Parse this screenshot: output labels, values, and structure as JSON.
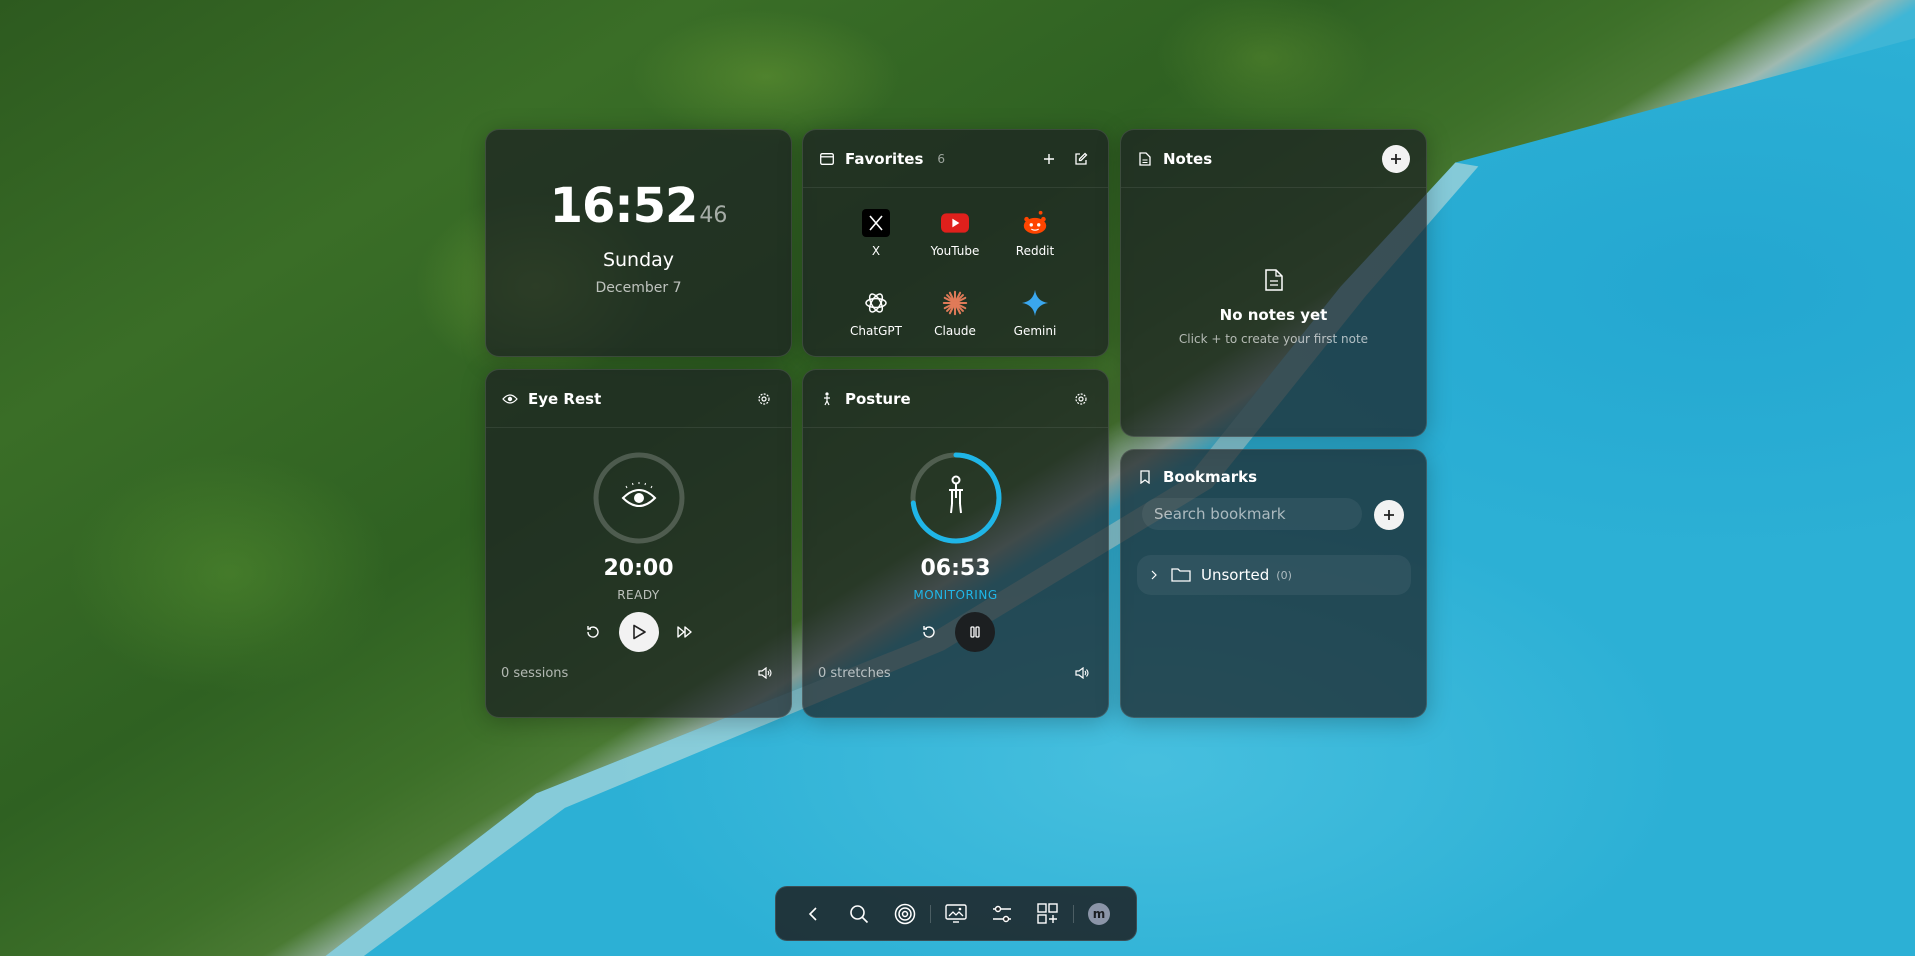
{
  "clock": {
    "hours_minutes": "16:52",
    "seconds": "46",
    "day": "Sunday",
    "date": "December 7"
  },
  "favorites": {
    "title": "Favorites",
    "count": "6",
    "items": [
      {
        "label": "X",
        "icon": "x-logo-icon"
      },
      {
        "label": "YouTube",
        "icon": "youtube-logo-icon"
      },
      {
        "label": "Reddit",
        "icon": "reddit-logo-icon"
      },
      {
        "label": "ChatGPT",
        "icon": "chatgpt-logo-icon"
      },
      {
        "label": "Claude",
        "icon": "claude-logo-icon"
      },
      {
        "label": "Gemini",
        "icon": "gemini-logo-icon"
      }
    ]
  },
  "notes": {
    "title": "Notes",
    "empty_title": "No notes yet",
    "empty_sub": "Click + to create your first note"
  },
  "eye_rest": {
    "title": "Eye Rest",
    "time": "20:00",
    "status": "READY",
    "sessions": "0 sessions",
    "progress": 0
  },
  "posture": {
    "title": "Posture",
    "time": "06:53",
    "status": "MONITORING",
    "stretches": "0 stretches",
    "progress": 0.73
  },
  "bookmarks": {
    "title": "Bookmarks",
    "search_placeholder": "Search bookmark",
    "folders": [
      {
        "name": "Unsorted",
        "count": "(0)"
      }
    ]
  },
  "dock": {
    "avatar_letter": "m"
  },
  "colors": {
    "accent": "#1fb6e8",
    "panel": "rgba(28,32,34,0.72)"
  }
}
